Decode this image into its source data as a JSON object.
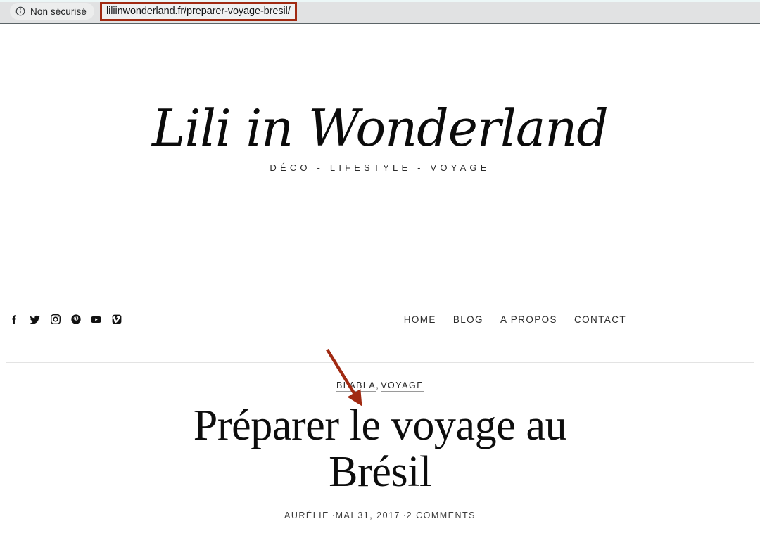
{
  "browser": {
    "security_label": "Non sécurisé",
    "security_icon": "info-circle-icon",
    "url": "liliinwonderland.fr/preparer-voyage-bresil/",
    "url_highlight_color": "#a12a12"
  },
  "site": {
    "logo_text": "Lili in Wonderland",
    "tagline": "DÉCO - LIFESTYLE - VOYAGE",
    "social": [
      {
        "name": "facebook-icon",
        "label": "Facebook"
      },
      {
        "name": "twitter-icon",
        "label": "Twitter"
      },
      {
        "name": "instagram-icon",
        "label": "Instagram"
      },
      {
        "name": "pinterest-icon",
        "label": "Pinterest"
      },
      {
        "name": "youtube-icon",
        "label": "YouTube"
      },
      {
        "name": "vimeo-icon",
        "label": "Vimeo"
      }
    ],
    "nav": [
      {
        "label": "HOME"
      },
      {
        "label": "BLOG"
      },
      {
        "label": "A PROPOS"
      },
      {
        "label": "CONTACT"
      }
    ]
  },
  "article": {
    "categories": [
      {
        "label": "BLABLA"
      },
      {
        "label": "VOYAGE"
      }
    ],
    "category_separator": ", ",
    "title": "Préparer le voyage au Brésil",
    "author": "AURÉLIE",
    "date": "MAI 31, 2017",
    "comments": "2 COMMENTS",
    "meta_separator": " ·"
  },
  "annotation": {
    "arrow_color": "#a12a12",
    "arrow_name": "red-annotation-arrow"
  }
}
